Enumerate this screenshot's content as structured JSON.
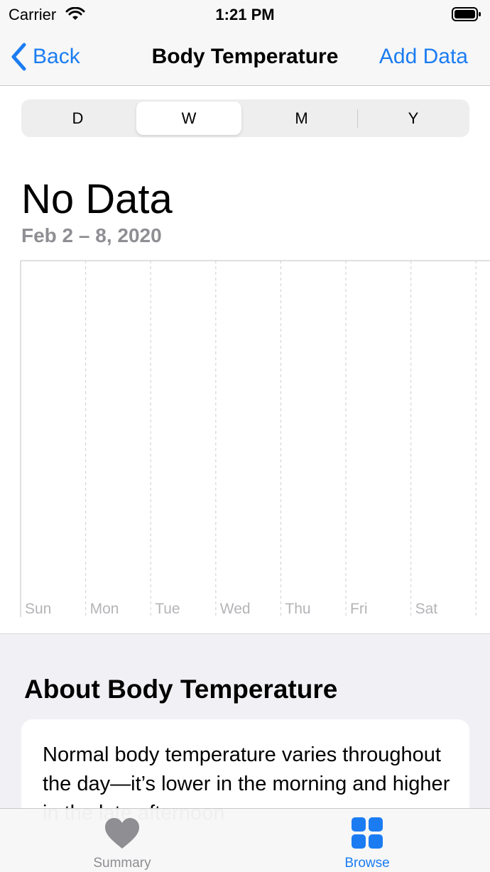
{
  "status_bar": {
    "carrier": "Carrier",
    "time": "1:21 PM",
    "wifi_icon": "wifi-icon",
    "battery_icon": "battery-icon"
  },
  "nav": {
    "back_label": "Back",
    "title": "Body Temperature",
    "add_data_label": "Add Data"
  },
  "segmented_control": {
    "segments": [
      "D",
      "W",
      "M",
      "Y"
    ],
    "selected": "W"
  },
  "headline": {
    "value": "No Data",
    "date_range": "Feb 2 – 8, 2020"
  },
  "chart_data": {
    "type": "bar",
    "categories": [
      "Sun",
      "Mon",
      "Tue",
      "Wed",
      "Thu",
      "Fri",
      "Sat"
    ],
    "values": [],
    "title": "",
    "xlabel": "",
    "ylabel": "",
    "grid": true
  },
  "about": {
    "title": "About Body Temperature",
    "text": "Normal body temperature varies throughout the day—it’s lower in the morning and higher in the late afternoon"
  },
  "tab_bar": {
    "summary_label": "Summary",
    "browse_label": "Browse",
    "summary_icon": "heart-icon",
    "browse_icon": "grid-icon",
    "selected": "Browse"
  },
  "colors": {
    "accent": "#1b7cf2",
    "inactive": "#8e8e93",
    "grid_line": "#d6d6da",
    "axis_label": "#b4b4b8"
  }
}
